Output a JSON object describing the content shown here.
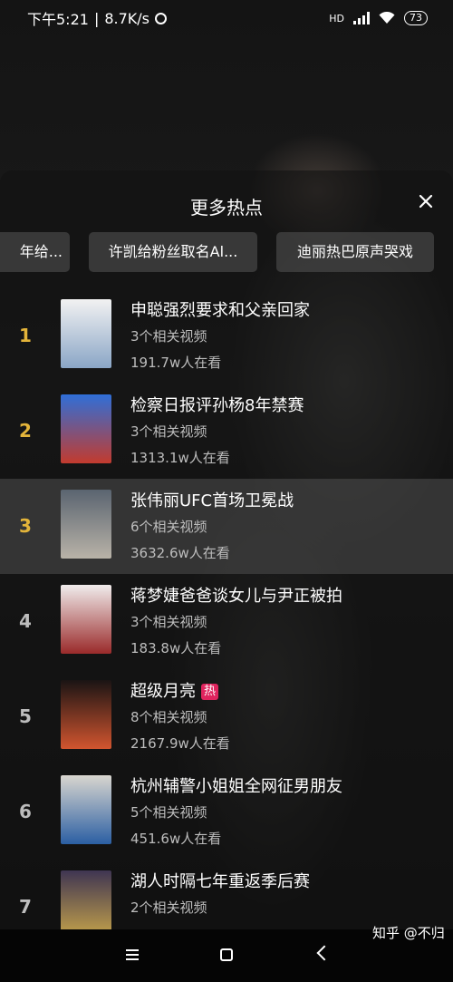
{
  "status": {
    "time": "下午5:21",
    "speed": "8.7K/s",
    "network": "HD",
    "battery": "73"
  },
  "panel": {
    "title": "更多热点"
  },
  "chips": [
    "年给...",
    "许凯给粉丝取名Al...",
    "迪丽热巴原声哭戏"
  ],
  "items": [
    {
      "rank": "1",
      "title": "申聪强烈要求和父亲回家",
      "count": "3个相关视频",
      "views": "191.7w人在看",
      "rank_color": "#e3b43a",
      "thumb_colors": [
        "#f2f2f2",
        "#8aa6c6"
      ]
    },
    {
      "rank": "2",
      "title": "检察日报评孙杨8年禁赛",
      "count": "3个相关视频",
      "views": "1313.1w人在看",
      "rank_color": "#e3b43a",
      "thumb_colors": [
        "#2f6fd8",
        "#c33b2e"
      ]
    },
    {
      "rank": "3",
      "title": "张伟丽UFC首场卫冕战",
      "count": "6个相关视频",
      "views": "3632.6w人在看",
      "rank_color": "#e3b43a",
      "thumb_colors": [
        "#5a6470",
        "#b9b3a8"
      ]
    },
    {
      "rank": "4",
      "title": "蒋梦婕爸爸谈女儿与尹正被拍",
      "count": "3个相关视频",
      "views": "183.8w人在看",
      "rank_color": "#bdbdbd",
      "thumb_colors": [
        "#f0ecec",
        "#9a2a2a"
      ]
    },
    {
      "rank": "5",
      "title": "超级月亮",
      "badge": "热",
      "count": "8个相关视频",
      "views": "2167.9w人在看",
      "rank_color": "#bdbdbd",
      "thumb_colors": [
        "#1a1414",
        "#d2552f"
      ]
    },
    {
      "rank": "6",
      "title": "杭州辅警小姐姐全网征男朋友",
      "count": "5个相关视频",
      "views": "451.6w人在看",
      "rank_color": "#bdbdbd",
      "thumb_colors": [
        "#d9d6cf",
        "#2b5fa3"
      ]
    },
    {
      "rank": "7",
      "title": "湖人时隔七年重返季后赛",
      "count": "2个相关视频",
      "views": "",
      "rank_color": "#bdbdbd",
      "thumb_colors": [
        "#3f3552",
        "#c9a64a"
      ]
    }
  ],
  "watermark": "知乎 @不归"
}
